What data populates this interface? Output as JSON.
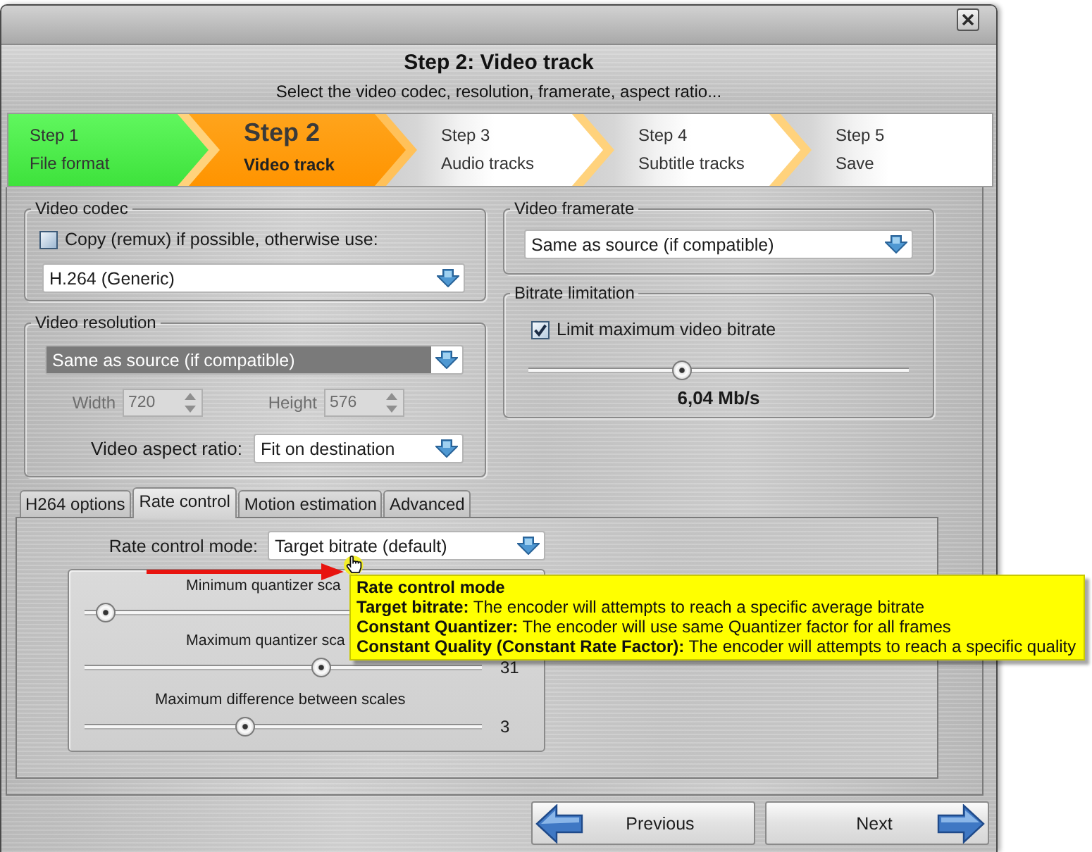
{
  "window": {
    "title": "Step 2: Video track",
    "subtitle": "Select the video codec, resolution, framerate, aspect ratio..."
  },
  "steps": [
    {
      "number": "Step 1",
      "name": "File format",
      "completed": true,
      "selected": false
    },
    {
      "number": "Step 2",
      "name": "Video track",
      "completed": false,
      "selected": true
    },
    {
      "number": "Step 3",
      "name": "Audio tracks",
      "completed": false,
      "selected": false
    },
    {
      "number": "Step 4",
      "name": "Subtitle tracks",
      "completed": false,
      "selected": false
    },
    {
      "number": "Step 5",
      "name": "Save",
      "completed": false,
      "selected": false
    }
  ],
  "video_codec": {
    "title": "Video codec",
    "copy_option": {
      "label": "Copy (remux) if possible, otherwise use:",
      "checked": false
    },
    "codec": {
      "value": "H.264 (Generic)"
    }
  },
  "video_resolution": {
    "title": "Video resolution",
    "resolution": {
      "value": "Same as source (if compatible)",
      "highlighted": true
    },
    "width": {
      "label": "Width",
      "value": "720",
      "disabled": true
    },
    "height": {
      "label": "Height",
      "value": "576",
      "disabled": true
    },
    "aspect_ratio": {
      "label": "Video aspect ratio:",
      "value": "Fit on destination"
    }
  },
  "video_framerate": {
    "title": "Video framerate",
    "framerate": {
      "value": "Same as source (if compatible)"
    }
  },
  "bitrate_limitation": {
    "title": "Bitrate limitation",
    "limit_option": {
      "label": "Limit maximum video bitrate",
      "checked": true
    },
    "bitrate": {
      "level": 0.4,
      "reading": "6,04 Mb/s"
    }
  },
  "tabs": [
    {
      "label": "H264 options",
      "selected": false
    },
    {
      "label": "Rate control",
      "selected": true
    },
    {
      "label": "Motion estimation",
      "selected": false
    },
    {
      "label": "Advanced",
      "selected": false
    }
  ],
  "rate_control": {
    "mode": {
      "label": "Rate control mode:",
      "value": "Target bitrate (default)"
    },
    "sliders": [
      {
        "label": "Minimum quantizer sca",
        "level": 0.03
      },
      {
        "label": "Maximum quantizer sca",
        "level": 0.6,
        "reading": "31"
      },
      {
        "label": "Maximum difference between scales",
        "level": 0.4,
        "reading": "3"
      }
    ]
  },
  "tooltip": {
    "title": "Rate control mode",
    "lines": [
      "**Target bitrate:** The encoder will attempts to reach a specific average bitrate",
      "**Constant Quantizer:** The encoder will use same Quantizer factor for all frames",
      "**Constant Quality (Constant Rate Factor):** The encoder will attempts to reach a specific quality"
    ]
  },
  "buttons": [
    {
      "label": "Previous",
      "kind": "previous"
    },
    {
      "label": "Next",
      "kind": "next"
    }
  ]
}
